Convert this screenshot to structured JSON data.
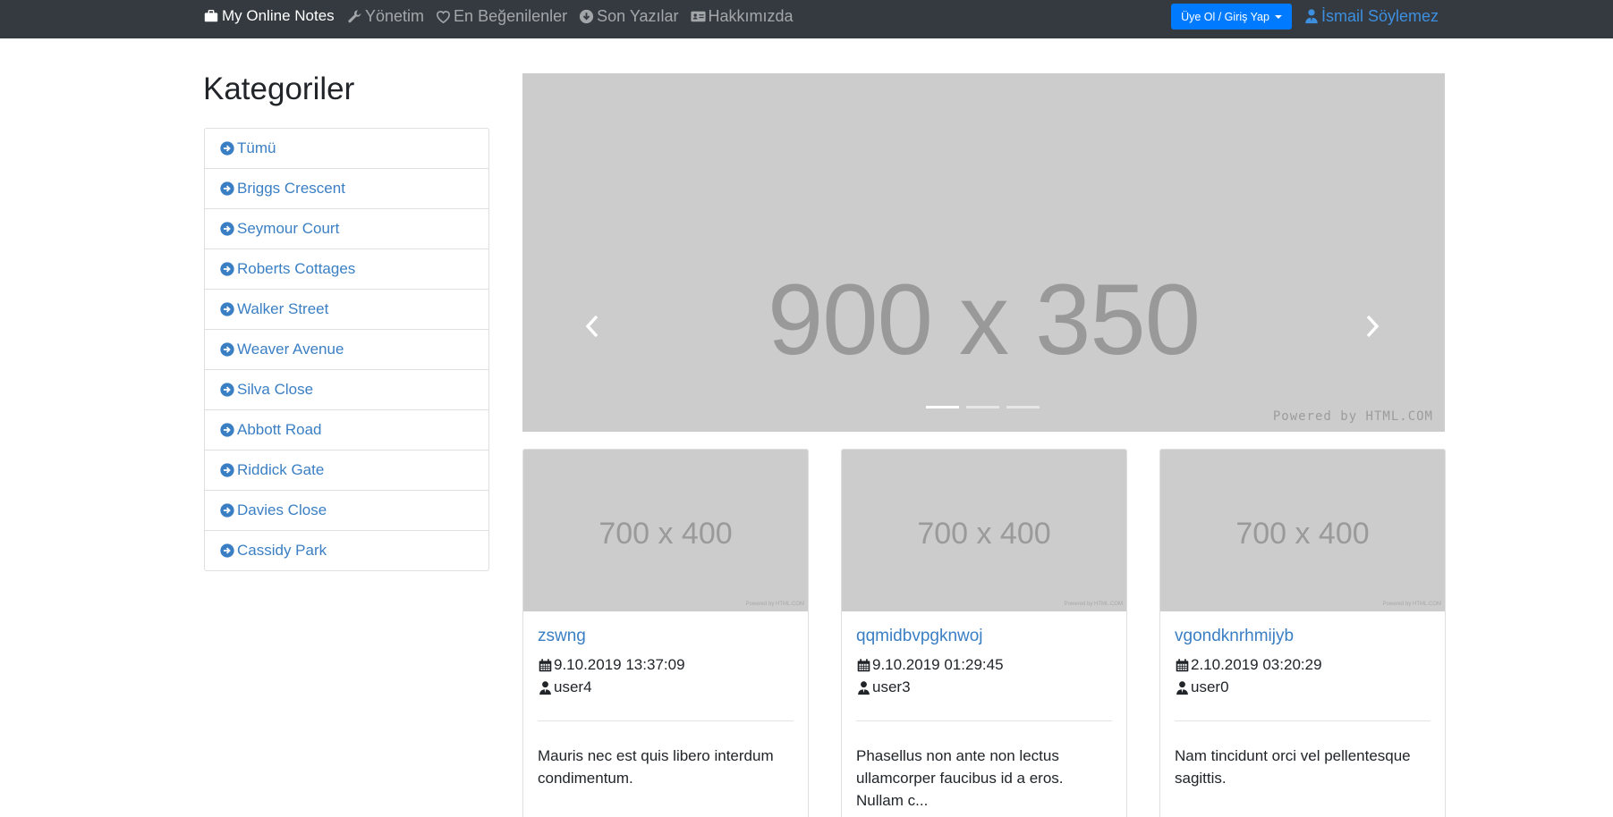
{
  "navbar": {
    "brand": "My Online Notes",
    "items": [
      {
        "label": "Yönetim",
        "icon": "wrench-icon"
      },
      {
        "label": "En Beğenilenler",
        "icon": "heart-icon"
      },
      {
        "label": "Son Yazılar",
        "icon": "arrow-circle-down-icon"
      },
      {
        "label": "Hakkımızda",
        "icon": "address-card-icon"
      }
    ],
    "signup_label": "Üye Ol / Giriş Yap",
    "user_name": "İsmail Söylemez"
  },
  "sidebar": {
    "title": "Kategoriler",
    "items": [
      {
        "label": "Tümü"
      },
      {
        "label": "Briggs Crescent"
      },
      {
        "label": "Seymour Court"
      },
      {
        "label": "Roberts Cottages"
      },
      {
        "label": "Walker Street"
      },
      {
        "label": "Weaver Avenue"
      },
      {
        "label": "Silva Close"
      },
      {
        "label": "Abbott Road"
      },
      {
        "label": "Riddick Gate"
      },
      {
        "label": "Davies Close"
      },
      {
        "label": "Cassidy Park"
      }
    ]
  },
  "carousel": {
    "placeholder": "900 x 350",
    "credit": "Powered by HTML.COM",
    "slides": 3,
    "active_slide": 0
  },
  "cards": [
    {
      "image_placeholder": "700 x 400",
      "image_credit": "Powered by HTML.COM",
      "title": "zswng",
      "date": "9.10.2019 13:37:09",
      "user": "user4",
      "text": "Mauris nec est quis libero interdum condimentum."
    },
    {
      "image_placeholder": "700 x 400",
      "image_credit": "Powered by HTML.COM",
      "title": "qqmidbvpgknwoj",
      "date": "9.10.2019 01:29:45",
      "user": "user3",
      "text": "Phasellus non ante non lectus ullamcorper faucibus id a eros. Nullam c..."
    },
    {
      "image_placeholder": "700 x 400",
      "image_credit": "Powered by HTML.COM",
      "title": "vgondknrhmijyb",
      "date": "2.10.2019 03:20:29",
      "user": "user0",
      "text": "Nam tincidunt orci vel pellentesque sagittis."
    }
  ],
  "colors": {
    "navbar_bg": "#343a40",
    "primary": "#007bff",
    "link": "#3a7fc4",
    "placeholder_bg": "#cccccc"
  }
}
